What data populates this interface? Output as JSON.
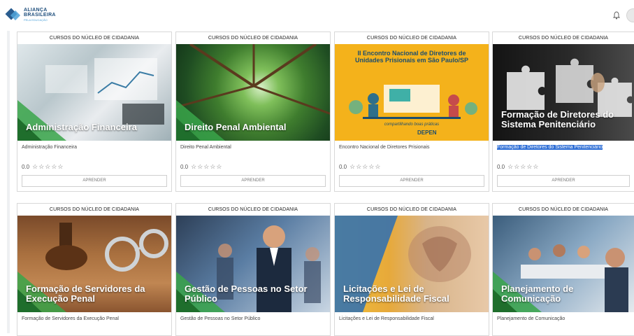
{
  "logo": {
    "line1": "ALIANÇA",
    "line2": "BRASILEIRA",
    "line3": "PELA EDUCAÇÃO"
  },
  "cards": [
    {
      "header": "CURSOS DO NÚCLEO DE CIDADANIA",
      "overlay": "Administração Financeira",
      "name": "Administração Financeira",
      "rating": "0.0",
      "stars": "☆☆☆☆☆",
      "button": "APRENDER"
    },
    {
      "header": "CURSOS DO NÚCLEO DE CIDADANIA",
      "overlay": "Direito Penal Ambiental",
      "name": "Direito Penal Ambiental",
      "rating": "0.0",
      "stars": "☆☆☆☆☆",
      "button": "APRENDER"
    },
    {
      "header": "CURSOS DO NÚCLEO DE CIDADANIA",
      "overlay": "II Encontro Nacional de Diretores de Unidades Prisionais em São Paulo/SP",
      "name": "Encontro Nacional de Diretores Prisionais",
      "rating": "0.0",
      "stars": "☆☆☆☆☆",
      "button": "APRENDER",
      "sub": "compartilhando boas práticas",
      "depen": "DEPEN"
    },
    {
      "header": "CURSOS DO NÚCLEO DE CIDADANIA",
      "overlay": "Formação de Diretores do Sistema Penitenciário",
      "name": "Formação de Diretores do Sistema Penitenciário",
      "rating": "0.0",
      "stars": "☆☆☆☆☆",
      "button": "APRENDER"
    },
    {
      "header": "CURSOS DO NÚCLEO DE CIDADANIA",
      "overlay": "Formação de Servidores da Execução Penal",
      "name": "Formação de Servidores da Execução Penal"
    },
    {
      "header": "CURSOS DO NÚCLEO DE CIDADANIA",
      "overlay": "Gestão de Pessoas no Setor Público",
      "name": "Gestão de Pessoas no Setor Público"
    },
    {
      "header": "CURSOS DO NÚCLEO DE CIDADANIA",
      "overlay": "Licitações e Lei de Responsabilidade Fiscal",
      "name": "Licitações e Lei de Responsabilidade Fiscal"
    },
    {
      "header": "CURSOS DO NÚCLEO DE CIDADANIA",
      "overlay": "Planejamento de Comunicação",
      "name": "Planejamento de Comunicação"
    }
  ]
}
